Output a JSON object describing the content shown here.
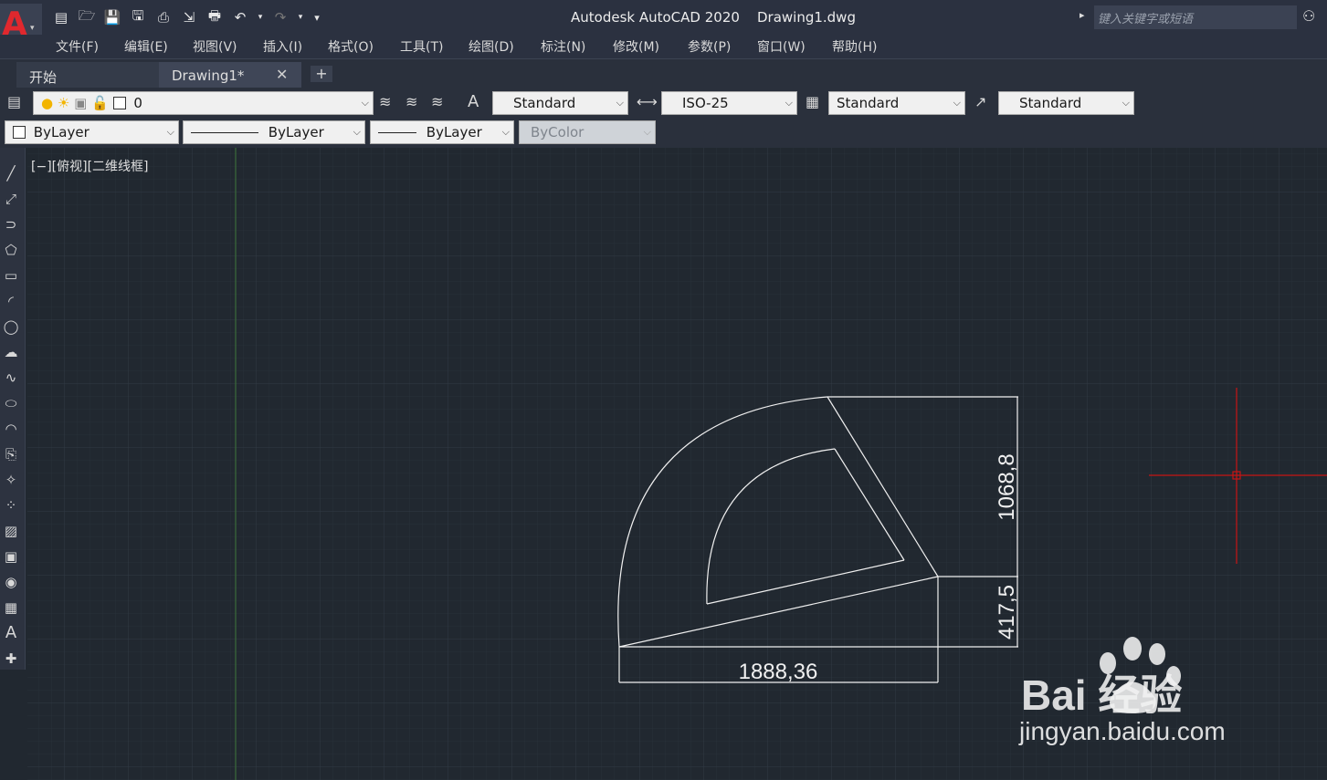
{
  "app": {
    "logo_letter": "A",
    "title": "Autodesk AutoCAD 2020    Drawing1.dwg",
    "search_placeholder": "键入关键字或短语"
  },
  "menu": [
    "文件(F)",
    "编辑(E)",
    "视图(V)",
    "插入(I)",
    "格式(O)",
    "工具(T)",
    "绘图(D)",
    "标注(N)",
    "修改(M)",
    "参数(P)",
    "窗口(W)",
    "帮助(H)"
  ],
  "tabs": {
    "start": "开始",
    "drawing": "Drawing1*",
    "close": "✕",
    "add": "+"
  },
  "toolbar": {
    "layer_value": "0",
    "text_style": "Standard",
    "dim_style": "ISO-25",
    "table_style": "Standard",
    "multileader_style": "Standard",
    "color": "ByLayer",
    "linetype": "ByLayer",
    "lineweight": "ByLayer",
    "plotstyle": "ByColor"
  },
  "viewport": {
    "label": "[−][俯视][二维线框]"
  },
  "dimensions": {
    "horizontal": "1888,36",
    "vertical_upper": "1068,8",
    "vertical_lower": "417,5"
  },
  "watermark": {
    "brand": "Bai  经验",
    "url": "jingyan.baidu.com"
  },
  "colors": {
    "canvas": "#212830",
    "grid_minor": "#283039",
    "grid_major": "#313a45",
    "y_axis": "#3a6b3a",
    "crosshair": "#c81414",
    "geometry": "#f0f0f0"
  }
}
